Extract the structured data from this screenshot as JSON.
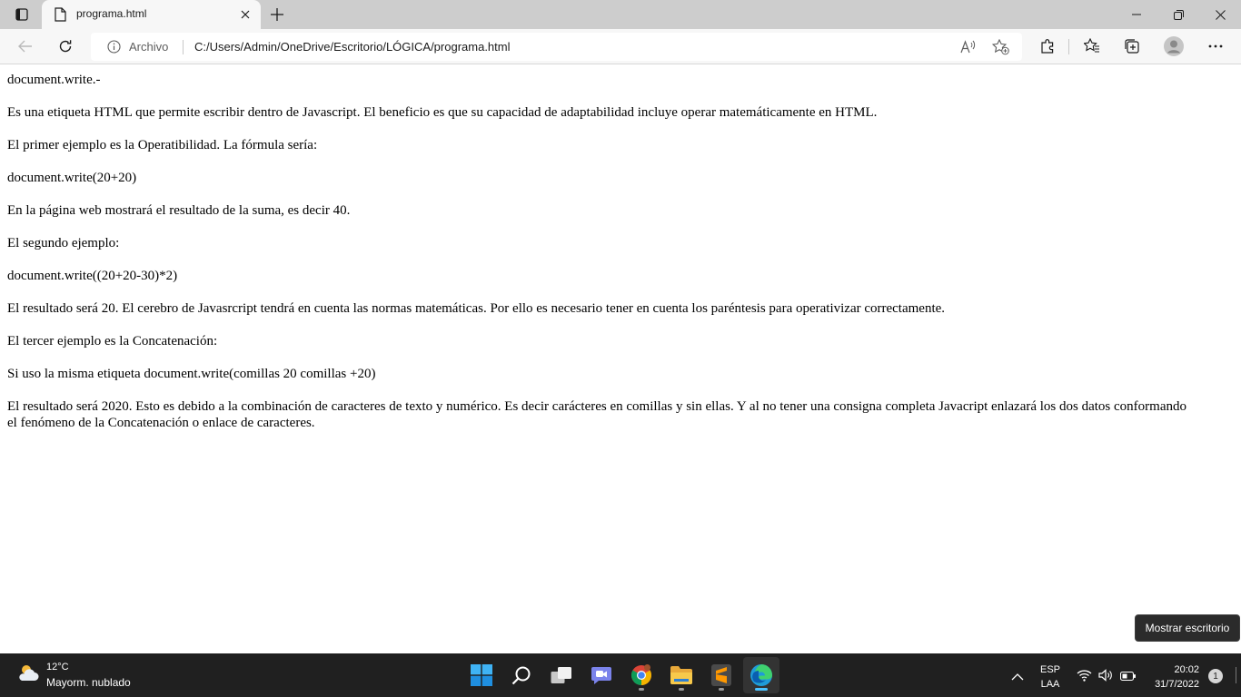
{
  "browser": {
    "tab_title": "programa.html",
    "site_label": "Archivo",
    "url": "C:/Users/Admin/OneDrive/Escritorio/LÓGICA/programa.html",
    "icons": [
      "tab-actions-icon",
      "file-icon",
      "close-icon",
      "plus-icon",
      "minimize-icon",
      "restore-icon",
      "back-arrow-icon",
      "reload-icon",
      "info-icon",
      "read-aloud-icon",
      "add-favorite-icon",
      "extensions-icon",
      "favorites-icon",
      "collections-icon",
      "profile-icon",
      "more-icon"
    ]
  },
  "page": {
    "paragraphs": [
      "document.write.-",
      "Es una etiqueta HTML que permite escribir dentro de Javascript. El beneficio es que su capacidad de adaptabilidad incluye operar matemáticamente en HTML.",
      "El primer ejemplo es la Operatibilidad. La fórmula sería:",
      "document.write(20+20)",
      "En la página web mostrará el resultado de la suma, es decir 40.",
      "El segundo ejemplo:",
      "document.write((20+20-30)*2)",
      "El resultado será 20. El cerebro de Javasrcript tendrá en cuenta las normas matemáticas. Por ello es necesario tener en cuenta los paréntesis para operativizar correctamente.",
      "El tercer ejemplo es la Concatenación:",
      "Si uso la misma etiqueta document.write(comillas 20 comillas +20)",
      "El resultado será 2020. Esto es debido a la combinación de caracteres de texto y numérico. Es decir carácteres en comillas y sin ellas. Y al no tener una consigna completa Javacript enlazará los dos datos conformando el fenómeno de la Concatenación o enlace de caracteres."
    ]
  },
  "tooltip": "Mostrar escritorio",
  "taskbar": {
    "weather_temp": "12°C",
    "weather_desc": "Mayorm. nublado",
    "apps": [
      "start",
      "search",
      "task-view",
      "chat",
      "chrome",
      "file-explorer",
      "sublime-text",
      "edge"
    ],
    "lang_line1": "ESP",
    "lang_line2": "LAA",
    "time": "20:02",
    "date": "31/7/2022",
    "notifications": "1"
  },
  "colors": {
    "taskbar": "#202020",
    "tab_strip": "#cdcdcd",
    "accent": "#4cc2ff"
  }
}
